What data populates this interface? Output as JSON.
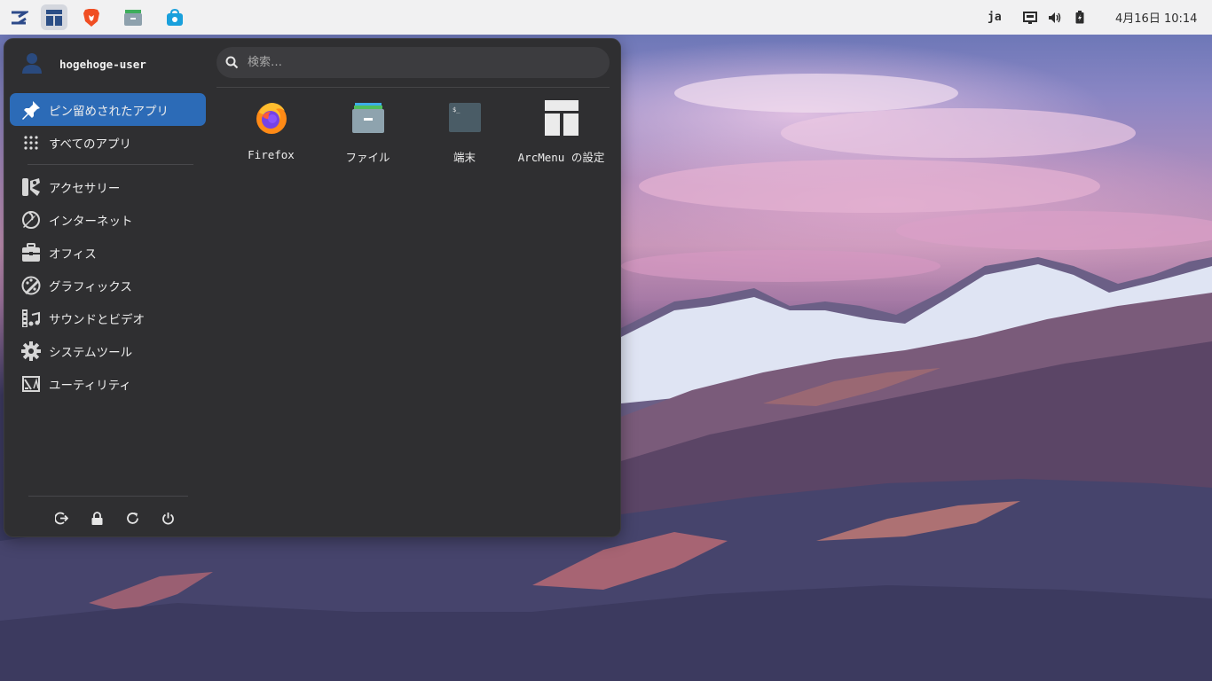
{
  "topbar": {
    "language": "ja",
    "datetime": "4月16日 10:14"
  },
  "menu": {
    "username": "hogehoge-user",
    "search": {
      "placeholder": "検索…"
    },
    "categories": [
      {
        "label": "ピン留めされたアプリ",
        "icon": "pin-icon",
        "selected": true
      },
      {
        "label": "すべてのアプリ",
        "icon": "grid-icon"
      },
      {
        "label": "アクセサリー",
        "icon": "accessories-icon"
      },
      {
        "label": "インターネット",
        "icon": "internet-icon"
      },
      {
        "label": "オフィス",
        "icon": "briefcase-icon"
      },
      {
        "label": "グラフィックス",
        "icon": "palette-icon"
      },
      {
        "label": "サウンドとビデオ",
        "icon": "multimedia-icon"
      },
      {
        "label": "システムツール",
        "icon": "gear-icon"
      },
      {
        "label": "ユーティリティ",
        "icon": "utilities-icon"
      }
    ],
    "pinned_apps": [
      {
        "label": "Firefox",
        "icon": "firefox-icon"
      },
      {
        "label": "ファイル",
        "icon": "files-icon"
      },
      {
        "label": "端末",
        "icon": "terminal-icon"
      },
      {
        "label": "ArcMenu の設定",
        "icon": "arcmenu-settings-icon"
      }
    ]
  },
  "colors": {
    "accent": "#2c6bb7",
    "menu_bg": "#2f2f31",
    "topbar_bg": "#f1f1f2"
  }
}
